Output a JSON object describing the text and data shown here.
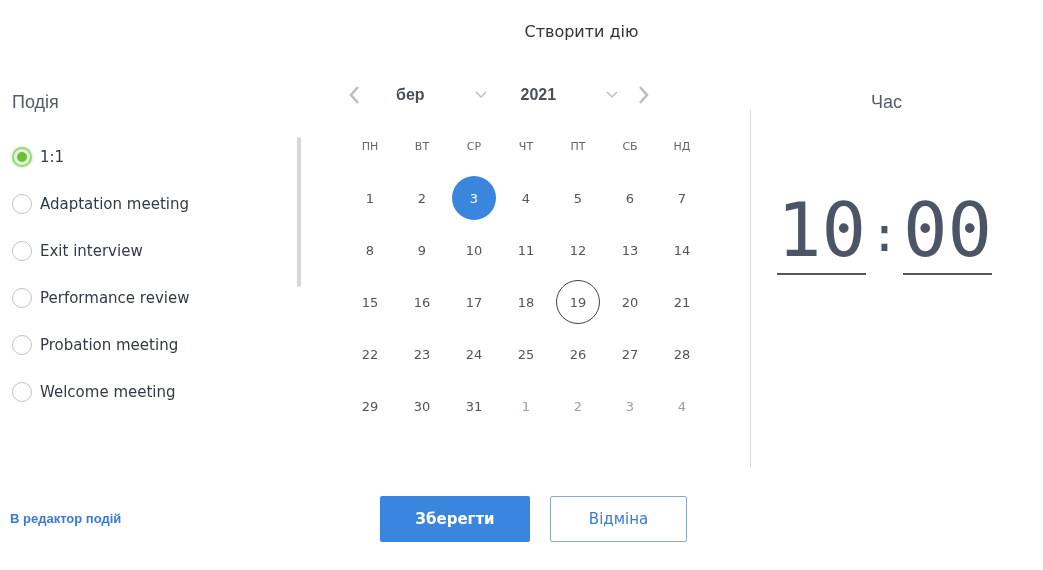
{
  "title": "Створити дію",
  "events": {
    "label": "Подія",
    "items": [
      {
        "label": "1:1",
        "selected": true
      },
      {
        "label": "Adaptation meeting",
        "selected": false
      },
      {
        "label": "Exit interview",
        "selected": false
      },
      {
        "label": "Performance review",
        "selected": false
      },
      {
        "label": "Probation meeting",
        "selected": false
      },
      {
        "label": "Welcome meeting",
        "selected": false
      }
    ]
  },
  "calendar": {
    "month": "бер",
    "year": "2021",
    "weekdays": [
      "ПН",
      "ВТ",
      "СР",
      "ЧТ",
      "ПТ",
      "СБ",
      "НД"
    ],
    "weeks": [
      [
        {
          "label": "1",
          "selected": false,
          "today": false,
          "outside": false
        },
        {
          "label": "2",
          "selected": false,
          "today": false,
          "outside": false
        },
        {
          "label": "3",
          "selected": true,
          "today": false,
          "outside": false
        },
        {
          "label": "4",
          "selected": false,
          "today": false,
          "outside": false
        },
        {
          "label": "5",
          "selected": false,
          "today": false,
          "outside": false
        },
        {
          "label": "6",
          "selected": false,
          "today": false,
          "outside": false
        },
        {
          "label": "7",
          "selected": false,
          "today": false,
          "outside": false
        }
      ],
      [
        {
          "label": "8",
          "selected": false,
          "today": false,
          "outside": false
        },
        {
          "label": "9",
          "selected": false,
          "today": false,
          "outside": false
        },
        {
          "label": "10",
          "selected": false,
          "today": false,
          "outside": false
        },
        {
          "label": "11",
          "selected": false,
          "today": false,
          "outside": false
        },
        {
          "label": "12",
          "selected": false,
          "today": false,
          "outside": false
        },
        {
          "label": "13",
          "selected": false,
          "today": false,
          "outside": false
        },
        {
          "label": "14",
          "selected": false,
          "today": false,
          "outside": false
        }
      ],
      [
        {
          "label": "15",
          "selected": false,
          "today": false,
          "outside": false
        },
        {
          "label": "16",
          "selected": false,
          "today": false,
          "outside": false
        },
        {
          "label": "17",
          "selected": false,
          "today": false,
          "outside": false
        },
        {
          "label": "18",
          "selected": false,
          "today": false,
          "outside": false
        },
        {
          "label": "19",
          "selected": false,
          "today": true,
          "outside": false
        },
        {
          "label": "20",
          "selected": false,
          "today": false,
          "outside": false
        },
        {
          "label": "21",
          "selected": false,
          "today": false,
          "outside": false
        }
      ],
      [
        {
          "label": "22",
          "selected": false,
          "today": false,
          "outside": false
        },
        {
          "label": "23",
          "selected": false,
          "today": false,
          "outside": false
        },
        {
          "label": "24",
          "selected": false,
          "today": false,
          "outside": false
        },
        {
          "label": "25",
          "selected": false,
          "today": false,
          "outside": false
        },
        {
          "label": "26",
          "selected": false,
          "today": false,
          "outside": false
        },
        {
          "label": "27",
          "selected": false,
          "today": false,
          "outside": false
        },
        {
          "label": "28",
          "selected": false,
          "today": false,
          "outside": false
        }
      ],
      [
        {
          "label": "29",
          "selected": false,
          "today": false,
          "outside": false
        },
        {
          "label": "30",
          "selected": false,
          "today": false,
          "outside": false
        },
        {
          "label": "31",
          "selected": false,
          "today": false,
          "outside": false
        },
        {
          "label": "1",
          "selected": false,
          "today": false,
          "outside": true
        },
        {
          "label": "2",
          "selected": false,
          "today": false,
          "outside": true
        },
        {
          "label": "3",
          "selected": false,
          "today": false,
          "outside": true
        },
        {
          "label": "4",
          "selected": false,
          "today": false,
          "outside": true
        }
      ]
    ]
  },
  "time": {
    "label": "Час",
    "hours": "10",
    "separator": ":",
    "minutes": "00"
  },
  "editor_link": "В редактор подій",
  "buttons": {
    "save": "Зберегти",
    "cancel": "Відміна"
  }
}
